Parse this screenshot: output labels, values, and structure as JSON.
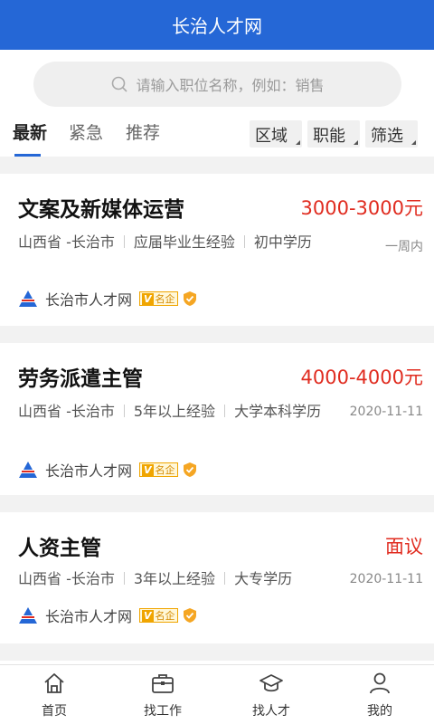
{
  "header": {
    "title": "长治人才网"
  },
  "search": {
    "placeholder": "请输入职位名称，例如：销售"
  },
  "tabs": [
    {
      "label": "最新",
      "active": true
    },
    {
      "label": "紧急",
      "active": false
    },
    {
      "label": "推荐",
      "active": false
    }
  ],
  "filters": [
    {
      "label": "区域"
    },
    {
      "label": "职能"
    },
    {
      "label": "筛选"
    }
  ],
  "jobs": [
    {
      "title": "文案及新媒体运营",
      "salary": "3000-3000元",
      "location": "山西省 -长治市",
      "experience": "应届毕业生经验",
      "education": "初中学历",
      "date": "一周内",
      "company": "长治市人才网",
      "badge": "名企"
    },
    {
      "title": "劳务派遣主管",
      "salary": "4000-4000元",
      "location": "山西省 -长治市",
      "experience": "5年以上经验",
      "education": "大学本科学历",
      "date": "2020-11-11",
      "company": "长治市人才网",
      "badge": "名企"
    },
    {
      "title": "人资主管",
      "salary": "面议",
      "location": "山西省 -长治市",
      "experience": "3年以上经验",
      "education": "大专学历",
      "date": "2020-11-11",
      "company": "长治市人才网",
      "badge": "名企"
    }
  ],
  "tabbar": [
    {
      "label": "首页",
      "icon": "home-icon"
    },
    {
      "label": "找工作",
      "icon": "briefcase-icon"
    },
    {
      "label": "找人才",
      "icon": "graduation-cap-icon"
    },
    {
      "label": "我的",
      "icon": "user-icon"
    }
  ],
  "colors": {
    "primary": "#2567d6",
    "salary": "#e02c20",
    "badge": "#f0a500"
  }
}
